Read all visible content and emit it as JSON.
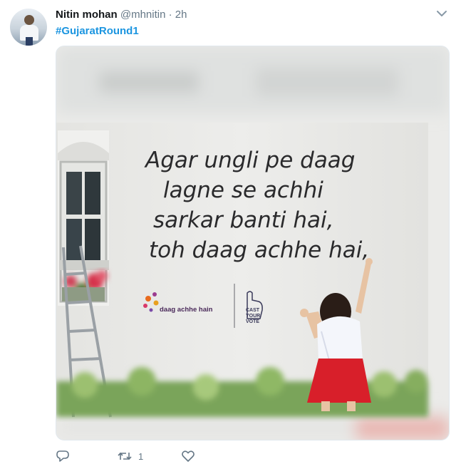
{
  "tweet": {
    "author_name": "Nitin mohan",
    "author_handle": "@mhnitin",
    "separator": "·",
    "time": "2h",
    "hashtag": "#GujaratRound1"
  },
  "image": {
    "wall_lines": [
      "Agar ungli pe daag",
      "lagne se achhi",
      "sarkar banti hai,",
      "toh daag achhe hai,"
    ],
    "brand_logo_text": "daag achhe hain",
    "vote_logo_text": [
      "CAST",
      "YOUR",
      "VOTE"
    ]
  },
  "actions": {
    "reply_icon": "reply-icon",
    "retweet_icon": "retweet-icon",
    "retweet_count": "1",
    "like_icon": "heart-icon"
  },
  "colors": {
    "link": "#1b95e0",
    "muted": "#657786",
    "skirt": "#d81f2a"
  }
}
